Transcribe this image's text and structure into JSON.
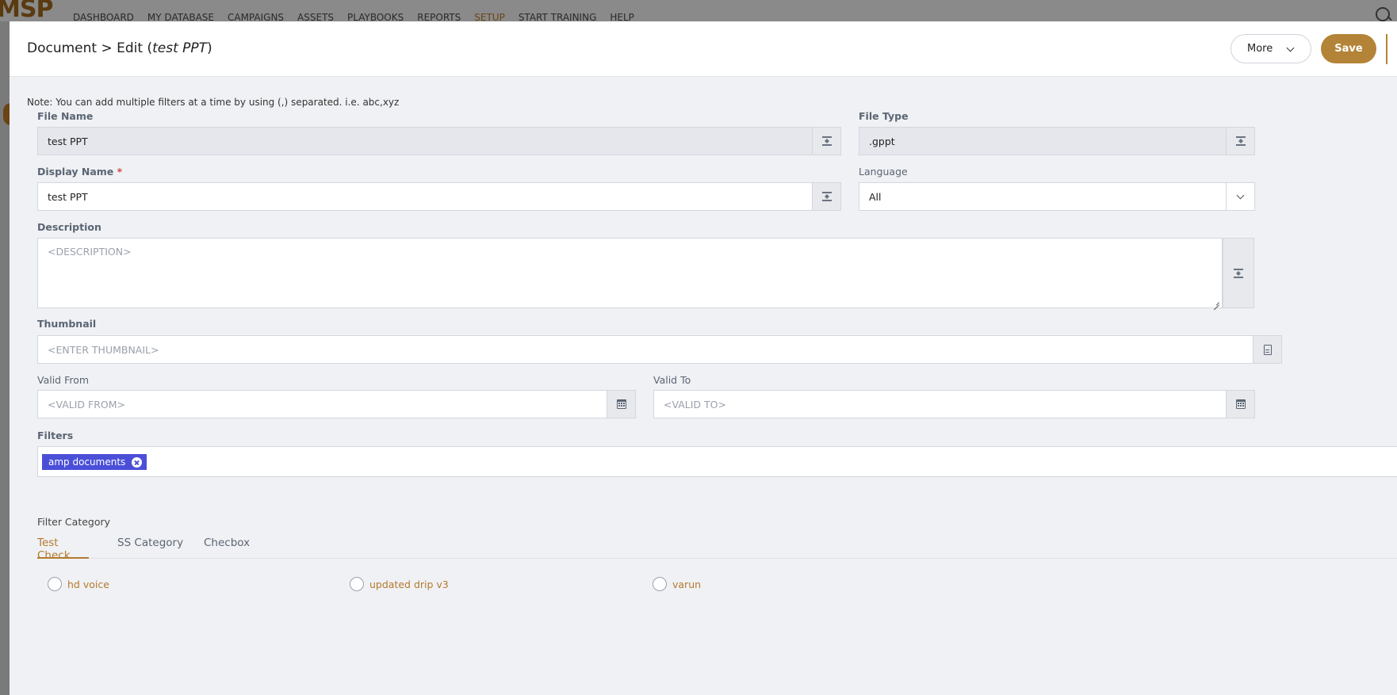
{
  "background_nav": {
    "logo": "MSP",
    "items": [
      "DASHBOARD",
      "MY DATABASE",
      "CAMPAIGNS",
      "ASSETS",
      "PLAYBOOKS",
      "REPORTS",
      "SETUP",
      "START TRAINING",
      "HELP"
    ],
    "active_item": "SETUP"
  },
  "header": {
    "title_prefix": "Document > Edit (",
    "title_name": "test PPT",
    "title_suffix": ")",
    "more_label": "More",
    "save_label": "Save"
  },
  "note": "Note: You can add multiple filters at a time by using (,) separated. i.e. abc,xyz",
  "form": {
    "file_name": {
      "label": "File Name",
      "value": "test PPT"
    },
    "file_type": {
      "label": "File Type",
      "value": ".gppt"
    },
    "display_name": {
      "label": "Display Name",
      "required": "*",
      "value": "test PPT"
    },
    "language": {
      "label": "Language",
      "value": "All"
    },
    "description": {
      "label": "Description",
      "placeholder": "<DESCRIPTION>"
    },
    "thumbnail": {
      "label": "Thumbnail",
      "placeholder": "<ENTER THUMBNAIL>"
    },
    "valid_from": {
      "label": "Valid From",
      "placeholder": "<VALID FROM>"
    },
    "valid_to": {
      "label": "Valid To",
      "placeholder": "<VALID TO>"
    },
    "filters": {
      "label": "Filters",
      "tags": [
        "amp documents"
      ]
    }
  },
  "filter_category": {
    "label": "Filter Category",
    "tabs": [
      "Test Check",
      "SS Category",
      "Checbox"
    ],
    "active_tab": "Test Check",
    "options": [
      "hd voice",
      "updated drip v3",
      "varun"
    ]
  },
  "colors": {
    "accent": "#b38437",
    "tag": "#4b4fd8",
    "required": "#d24a4a"
  }
}
